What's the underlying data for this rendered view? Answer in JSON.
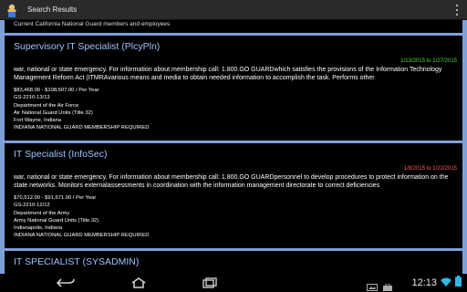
{
  "actionbar": {
    "title": "Search Results"
  },
  "previous_card": {
    "text": "Current California National Guard members and employees"
  },
  "results": [
    {
      "title": "Supervisory IT Specialist (PlcyPln)",
      "dates": "1/13/2015 to 1/27/2015",
      "description": "war, national or state emergency. For information about membership call: 1.800.GO GUARDwhich satisfies the provisions of the Information Technology Management Reform Act (ITMRAvarious means and media to obtain needed information to accomplish the task. Performs other",
      "salary": "$83,468.00 - $108,507.00 / Per Year",
      "grade": "GS-2210-13/13",
      "department": "Department of the Air Force",
      "agency": "Air National Guard Units (Title 32)",
      "location": "Fort Wayne, Indiana",
      "requirement": "INDIANA NATIONAL GUARD MEMBERSHIP REQUIRED"
    },
    {
      "title": "IT Specialist (InfoSec)",
      "dates": "1/8/2015 to 1/22/2015",
      "description": "war, national or state emergency. For information about membership call: 1.800.GO GUARDpersonnel to develop procedures to protect information on the state networks. Monitors externalassessments in coordination with the information management directorate to correct deficiencies",
      "salary": "$70,512.00 - $91,671.00 / Per Year",
      "grade": "GS-2210-12/12",
      "department": "Department of the Army",
      "agency": "Army National Guard Units (Title 32)",
      "location": "Indianapolis, Indiana",
      "requirement": "INDIANA NATIONAL GUARD MEMBERSHIP REQUIRED"
    },
    {
      "title": "IT SPECIALIST (SYSADMIN)"
    }
  ],
  "statusbar": {
    "time": "12:13"
  },
  "colors": {
    "background": "#7f9fd9",
    "title": "#9fc3ff",
    "date_green": "#56d84a",
    "date_red": "#ff5d4f"
  },
  "icons": [
    "app-user-icon",
    "overflow-menu-icon",
    "back-icon",
    "home-icon",
    "recent-apps-icon",
    "notification-image-icon",
    "notification-bag-icon",
    "wifi-icon",
    "battery-icon"
  ]
}
